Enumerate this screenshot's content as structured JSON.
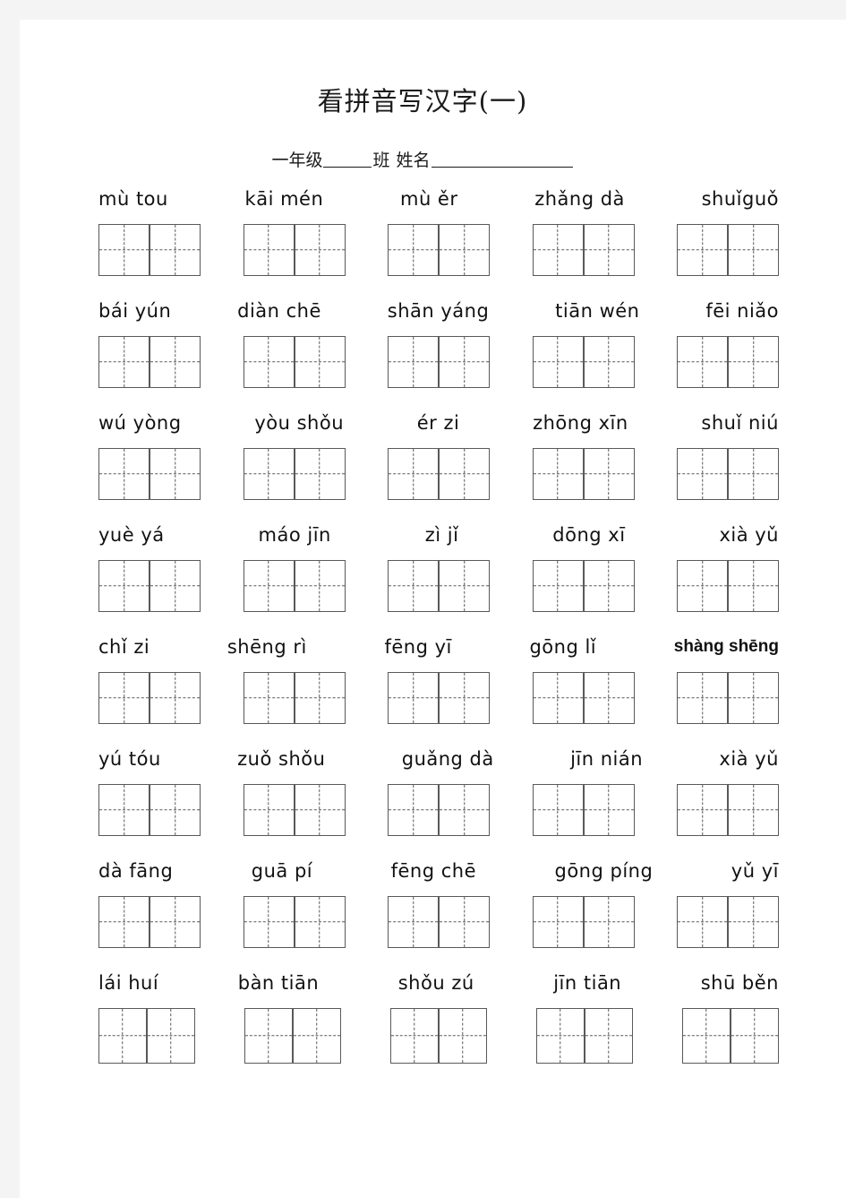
{
  "document": {
    "title": "看拼音写汉字(一)",
    "subtitle": {
      "grade_label": "一年级",
      "class_label": "班",
      "name_label": "姓名"
    }
  },
  "worksheet": {
    "boxes_per_word": 2,
    "columns": 5,
    "rows": [
      {
        "index": 1,
        "words": [
          {
            "pinyin": "mù tou",
            "bold": false
          },
          {
            "pinyin": "kāi mén",
            "bold": false
          },
          {
            "pinyin": "mù ěr",
            "bold": false
          },
          {
            "pinyin": "zhǎng dà",
            "bold": false
          },
          {
            "pinyin": "shuǐguǒ",
            "bold": false
          }
        ]
      },
      {
        "index": 2,
        "words": [
          {
            "pinyin": "bái yún",
            "bold": false
          },
          {
            "pinyin": "diàn chē",
            "bold": false
          },
          {
            "pinyin": "shān yáng",
            "bold": false
          },
          {
            "pinyin": "tiān wén",
            "bold": false
          },
          {
            "pinyin": "fēi niǎo",
            "bold": false
          }
        ]
      },
      {
        "index": 3,
        "words": [
          {
            "pinyin": "wú yòng",
            "bold": false
          },
          {
            "pinyin": "yòu shǒu",
            "bold": false
          },
          {
            "pinyin": "ér  zi",
            "bold": false
          },
          {
            "pinyin": "zhōng xīn",
            "bold": false
          },
          {
            "pinyin": "shuǐ niú",
            "bold": false
          }
        ]
      },
      {
        "index": 4,
        "words": [
          {
            "pinyin": "yuè  yá",
            "bold": false
          },
          {
            "pinyin": "máo jīn",
            "bold": false
          },
          {
            "pinyin": "zì  jǐ",
            "bold": false
          },
          {
            "pinyin": "dōng xī",
            "bold": false
          },
          {
            "pinyin": "xià  yǔ",
            "bold": false
          }
        ]
      },
      {
        "index": 5,
        "words": [
          {
            "pinyin": "chǐ  zi",
            "bold": false
          },
          {
            "pinyin": "shēng rì",
            "bold": false
          },
          {
            "pinyin": "fēng yī",
            "bold": false
          },
          {
            "pinyin": "gōng lǐ",
            "bold": false
          },
          {
            "pinyin": "shàng shēng",
            "bold": true
          }
        ]
      },
      {
        "index": 6,
        "words": [
          {
            "pinyin": "yú tóu",
            "bold": false
          },
          {
            "pinyin": "zuǒ shǒu",
            "bold": false
          },
          {
            "pinyin": "guǎng dà",
            "bold": false
          },
          {
            "pinyin": "jīn nián",
            "bold": false
          },
          {
            "pinyin": "xià yǔ",
            "bold": false
          }
        ]
      },
      {
        "index": 7,
        "words": [
          {
            "pinyin": "dà fāng",
            "bold": false
          },
          {
            "pinyin": "guā pí",
            "bold": false
          },
          {
            "pinyin": "fēng chē",
            "bold": false
          },
          {
            "pinyin": "gōng píng",
            "bold": false
          },
          {
            "pinyin": "yǔ yī",
            "bold": false
          }
        ]
      },
      {
        "index": 8,
        "words": [
          {
            "pinyin": "lái huí",
            "bold": false
          },
          {
            "pinyin": "bàn tiān",
            "bold": false
          },
          {
            "pinyin": "shǒu zú",
            "bold": false
          },
          {
            "pinyin": "jīn tiān",
            "bold": false
          },
          {
            "pinyin": "shū běn",
            "bold": false
          }
        ]
      }
    ]
  },
  "colors": {
    "paper": "#ffffff",
    "gutter": "#f4f4f4",
    "ink": "#1a1a1a",
    "grid_line": "#595959"
  }
}
